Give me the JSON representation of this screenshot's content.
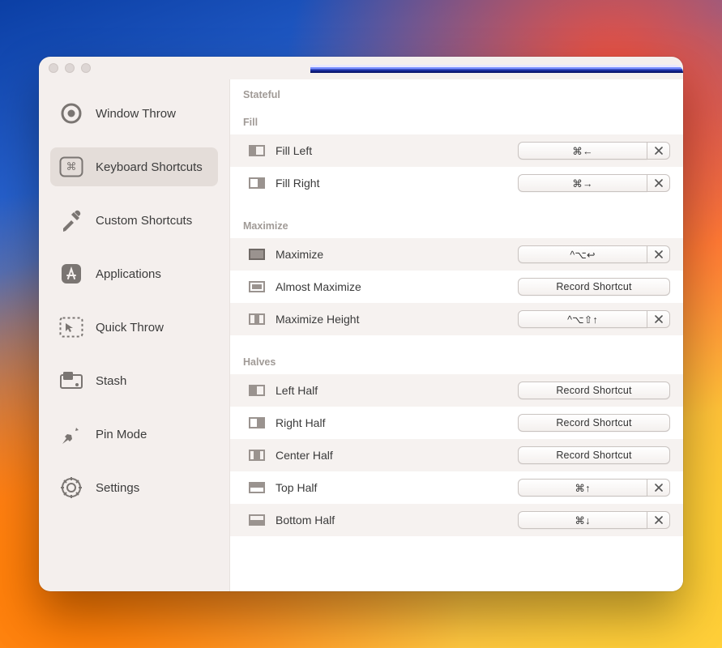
{
  "sidebar": {
    "items": [
      {
        "id": "window-throw",
        "label": "Window Throw"
      },
      {
        "id": "keyboard-shortcuts",
        "label": "Keyboard Shortcuts"
      },
      {
        "id": "custom-shortcuts",
        "label": "Custom Shortcuts"
      },
      {
        "id": "applications",
        "label": "Applications"
      },
      {
        "id": "quick-throw",
        "label": "Quick Throw"
      },
      {
        "id": "stash",
        "label": "Stash"
      },
      {
        "id": "pin-mode",
        "label": "Pin Mode"
      },
      {
        "id": "settings",
        "label": "Settings"
      }
    ],
    "active_index": 1
  },
  "strings": {
    "record_shortcut": "Record Shortcut"
  },
  "main": {
    "title": "Stateful",
    "sections": [
      {
        "title": "Fill",
        "rows": [
          {
            "id": "fill-left",
            "label": "Fill Left",
            "shortcut": "⌘←",
            "clearable": true
          },
          {
            "id": "fill-right",
            "label": "Fill Right",
            "shortcut": "⌘→",
            "clearable": true
          }
        ]
      },
      {
        "title": "Maximize",
        "rows": [
          {
            "id": "maximize",
            "label": "Maximize",
            "shortcut": "^⌥↩",
            "clearable": true
          },
          {
            "id": "almost-maximize",
            "label": "Almost Maximize",
            "shortcut": null,
            "clearable": false
          },
          {
            "id": "maximize-height",
            "label": "Maximize Height",
            "shortcut": "^⌥⇧↑",
            "clearable": true
          }
        ]
      },
      {
        "title": "Halves",
        "rows": [
          {
            "id": "left-half",
            "label": "Left Half",
            "shortcut": null,
            "clearable": false
          },
          {
            "id": "right-half",
            "label": "Right Half",
            "shortcut": null,
            "clearable": false
          },
          {
            "id": "center-half",
            "label": "Center Half",
            "shortcut": null,
            "clearable": false
          },
          {
            "id": "top-half",
            "label": "Top Half",
            "shortcut": "⌘↑",
            "clearable": true
          },
          {
            "id": "bottom-half",
            "label": "Bottom Half",
            "shortcut": "⌘↓",
            "clearable": true
          }
        ]
      }
    ]
  }
}
